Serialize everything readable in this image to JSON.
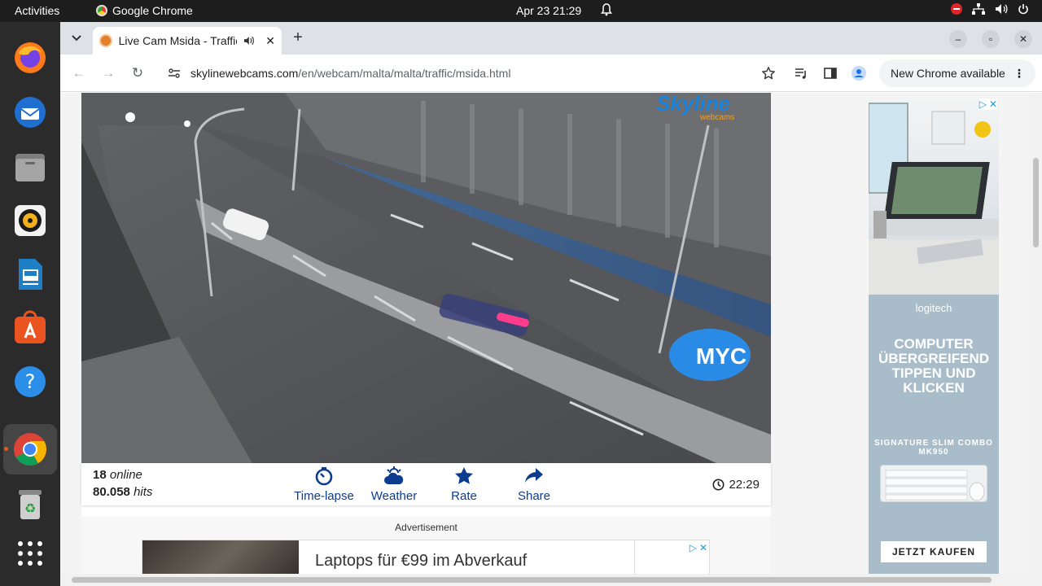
{
  "topbar": {
    "activities": "Activities",
    "app_name": "Google Chrome",
    "clock": "Apr 23  21:29"
  },
  "browser": {
    "tab_title": "Live Cam Msida - Traffic",
    "url_host": "skylinewebcams.com",
    "url_path": "/en/webcam/malta/malta/traffic/msida.html",
    "update_label": "New Chrome available"
  },
  "webcam": {
    "logo_main": "Skyline",
    "logo_sub": "webcams",
    "overlay_logo": "MYC",
    "online_count": "18",
    "online_label": "online",
    "hits_count": "80.058",
    "hits_label": "hits",
    "actions": [
      "Time-lapse",
      "Weather",
      "Rate",
      "Share"
    ],
    "local_time": "22:29"
  },
  "ads": {
    "label": "Advertisement",
    "banner_text": "Laptops für €99 im Abverkauf",
    "side_brand": "logitech",
    "side_headline": "COMPUTER ÜBERGREIFEND TIPPEN UND KLICKEN",
    "side_product": "SIGNATURE SLIM COMBO MK950",
    "side_cta": "JETZT KAUFEN"
  },
  "colors": {
    "accent_blue": "#0d3b8e",
    "ubuntu_orange": "#e95420"
  }
}
